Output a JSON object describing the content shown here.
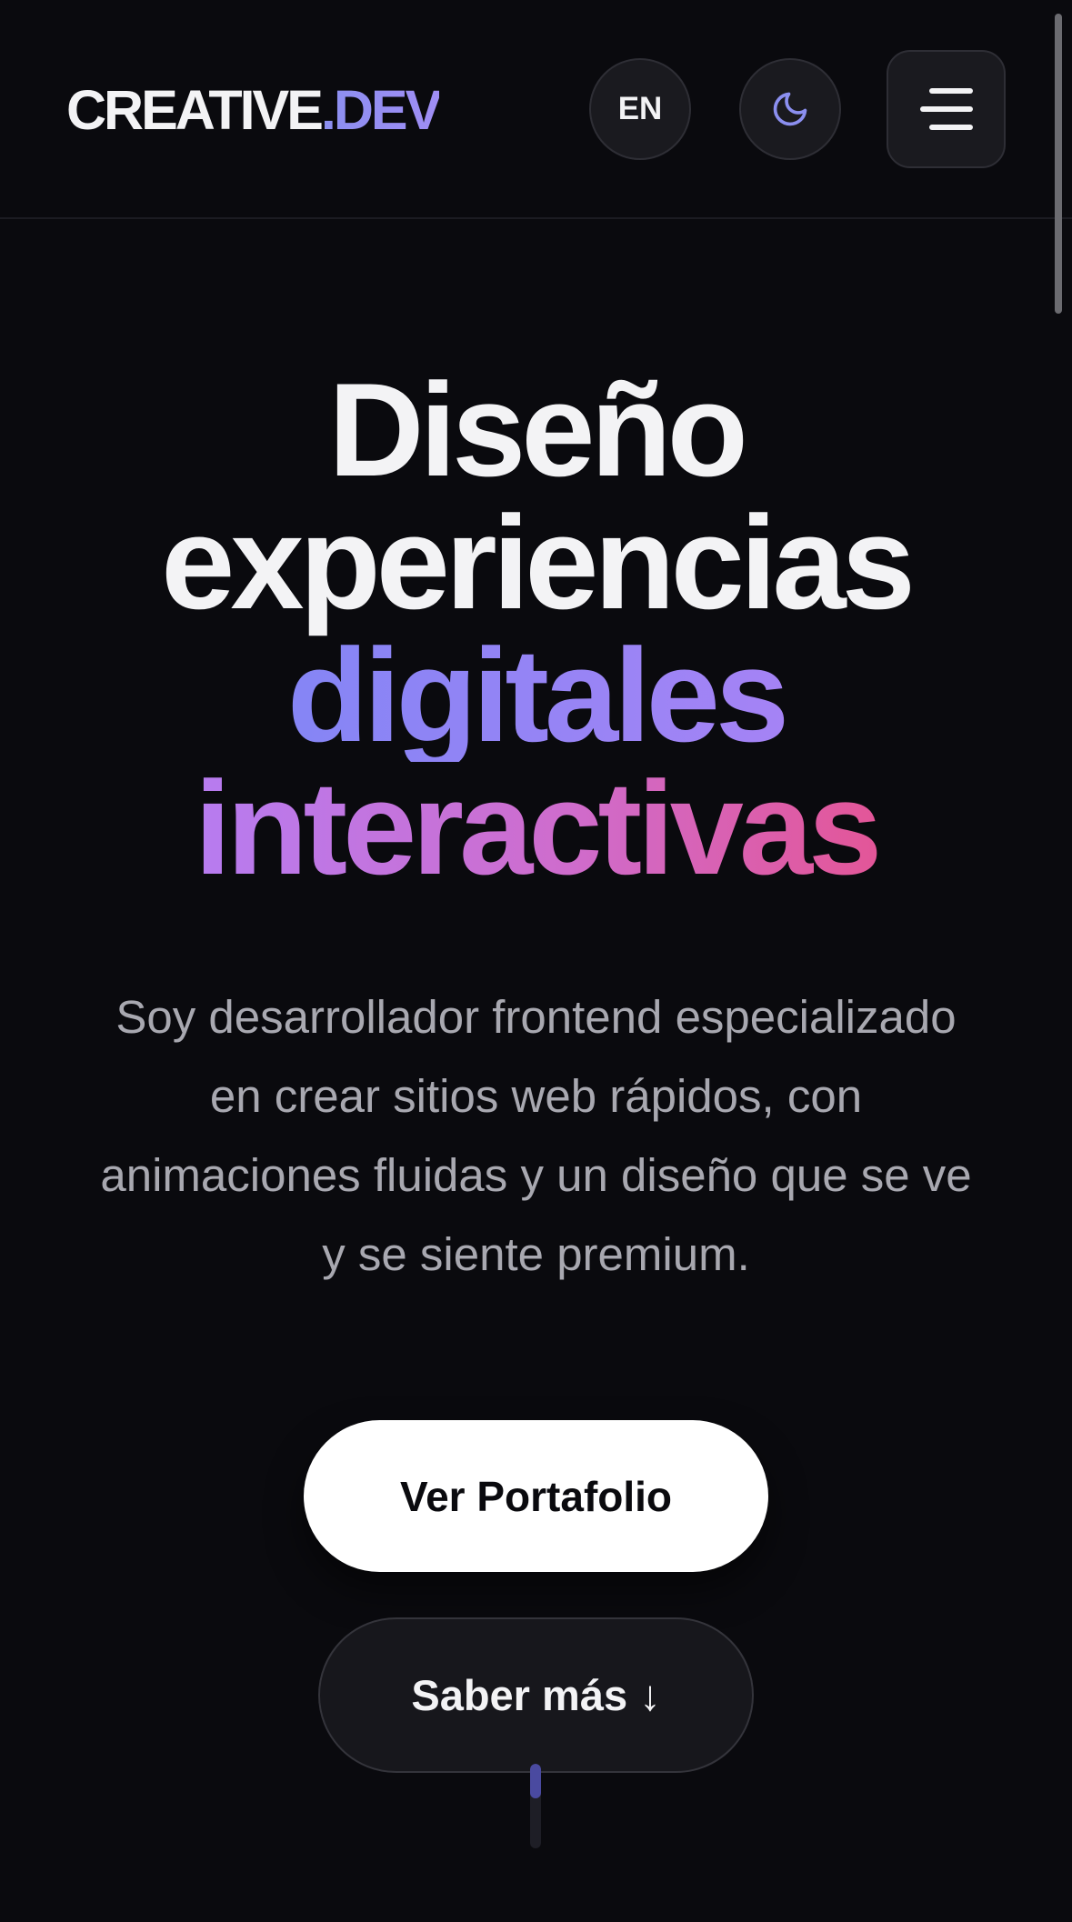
{
  "header": {
    "logo_main": "CREATIVE",
    "logo_accent": ".DEV",
    "lang_label": "EN",
    "theme_icon": "moon-icon",
    "menu_icon": "hamburger-menu-icon"
  },
  "hero": {
    "title_line1": "Diseño",
    "title_line2": "experiencias",
    "title_line3": "digitales",
    "title_line4": "interactivas",
    "subtitle": "Soy desarrollador frontend especializado en crear sitios web rápidos, con animaciones fluidas y un diseño que se ve y se siente premium.",
    "primary_button": "Ver Portafolio",
    "secondary_button": "Saber más ↓"
  },
  "colors": {
    "background": "#0a0a0e",
    "accent_indigo": "#8585f5",
    "accent_violet": "#b77cf0",
    "accent_pink": "#e35698",
    "text_muted": "#a8a8b0"
  }
}
